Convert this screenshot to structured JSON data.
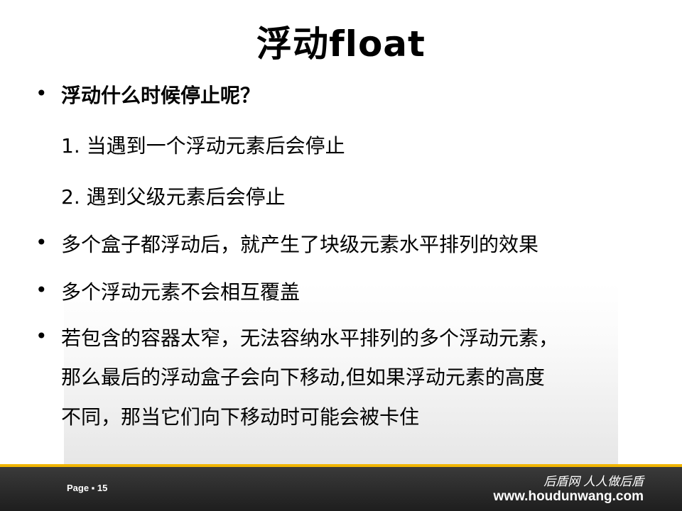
{
  "title": "浮动float",
  "bullets": [
    {
      "text": "浮动什么时候停止呢？",
      "bold": true
    },
    {
      "text": "1. 当遇到一个浮动元素后会停止"
    },
    {
      "text": "2. 遇到父级元素后会停止"
    },
    {
      "text": "多个盒子都浮动后，就产生了块级元素水平排列的效果"
    },
    {
      "text": "多个浮动元素不会相互覆盖"
    },
    {
      "text": "若包含的容器太窄，无法容纳水平排列的多个浮动元素，"
    },
    {
      "text": "那么最后的浮动盒子会向下移动,但如果浮动元素的高度"
    },
    {
      "text": "不同，那当它们向下移动时可能会被卡住"
    }
  ],
  "bullet_char": "•",
  "footer": {
    "page": "Page ▪ 15",
    "slogan": "后盾网 人人做后盾",
    "url": "www.houdunwang.com"
  }
}
